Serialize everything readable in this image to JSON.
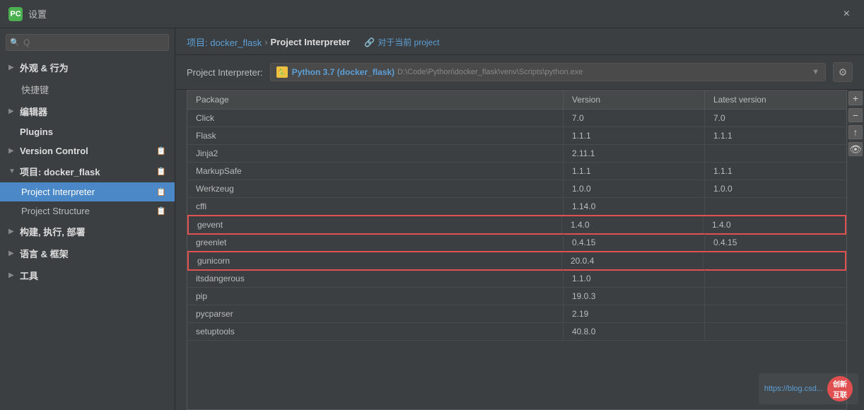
{
  "titleBar": {
    "icon": "PC",
    "title": "设置",
    "closeLabel": "×"
  },
  "breadcrumb": {
    "projectLink": "项目: docker_flask",
    "separator": "›",
    "current": "Project Interpreter",
    "tagIcon": "🔗",
    "tagText": "对于当前 project"
  },
  "interpreterRow": {
    "label": "Project Interpreter:",
    "selectIcon": "🐍",
    "selectName": "Python 3.7 (docker_flask)",
    "selectPath": "D:\\Code\\Python\\docker_flask\\venv\\Scripts\\python.exe",
    "gearIcon": "⚙"
  },
  "table": {
    "headers": [
      "Package",
      "Version",
      "Latest version"
    ],
    "rows": [
      {
        "package": "Click",
        "version": "7.0",
        "latest": "7.0",
        "highlighted": false
      },
      {
        "package": "Flask",
        "version": "1.1.1",
        "latest": "1.1.1",
        "highlighted": false
      },
      {
        "package": "Jinja2",
        "version": "2.11.1",
        "latest": "",
        "highlighted": false
      },
      {
        "package": "MarkupSafe",
        "version": "1.1.1",
        "latest": "1.1.1",
        "highlighted": false
      },
      {
        "package": "Werkzeug",
        "version": "1.0.0",
        "latest": "1.0.0",
        "highlighted": false
      },
      {
        "package": "cffi",
        "version": "1.14.0",
        "latest": "",
        "highlighted": false
      },
      {
        "package": "gevent",
        "version": "1.4.0",
        "latest": "1.4.0",
        "highlighted": true
      },
      {
        "package": "greenlet",
        "version": "0.4.15",
        "latest": "0.4.15",
        "highlighted": false
      },
      {
        "package": "gunicorn",
        "version": "20.0.4",
        "latest": "",
        "highlighted": true
      },
      {
        "package": "itsdangerous",
        "version": "1.1.0",
        "latest": "",
        "highlighted": false
      },
      {
        "package": "pip",
        "version": "19.0.3",
        "latest": "",
        "highlighted": false
      },
      {
        "package": "pycparser",
        "version": "2.19",
        "latest": "",
        "highlighted": false
      },
      {
        "package": "setuptools",
        "version": "40.8.0",
        "latest": "",
        "highlighted": false
      }
    ]
  },
  "tableActions": [
    "+",
    "−",
    "↑",
    "👁"
  ],
  "sidebar": {
    "searchPlaceholder": "Q",
    "items": [
      {
        "id": "appearance",
        "label": "外观 & 行为",
        "indent": 0,
        "expandable": true,
        "expanded": false,
        "icon_right": ""
      },
      {
        "id": "shortcuts",
        "label": "快捷键",
        "indent": 1,
        "expandable": false,
        "icon_right": ""
      },
      {
        "id": "editor",
        "label": "编辑器",
        "indent": 0,
        "expandable": true,
        "expanded": false,
        "icon_right": ""
      },
      {
        "id": "plugins",
        "label": "Plugins",
        "indent": 0,
        "expandable": false,
        "icon_right": ""
      },
      {
        "id": "vcs",
        "label": "Version Control",
        "indent": 0,
        "expandable": true,
        "expanded": false,
        "icon_right": "📋"
      },
      {
        "id": "project",
        "label": "项目: docker_flask",
        "indent": 0,
        "expandable": true,
        "expanded": true,
        "icon_right": "📋"
      },
      {
        "id": "project-interpreter",
        "label": "Project Interpreter",
        "indent": 1,
        "expandable": false,
        "active": true,
        "icon_right": "📋"
      },
      {
        "id": "project-structure",
        "label": "Project Structure",
        "indent": 1,
        "expandable": false,
        "icon_right": "📋"
      },
      {
        "id": "build",
        "label": "构建, 执行, 部署",
        "indent": 0,
        "expandable": true,
        "expanded": false,
        "icon_right": ""
      },
      {
        "id": "language",
        "label": "语言 & 框架",
        "indent": 0,
        "expandable": true,
        "expanded": false,
        "icon_right": ""
      },
      {
        "id": "tools",
        "label": "工具",
        "indent": 0,
        "expandable": true,
        "expanded": false,
        "icon_right": ""
      }
    ]
  },
  "watermark": {
    "url": "https://blog.csd...",
    "logoText": "创新互联"
  }
}
